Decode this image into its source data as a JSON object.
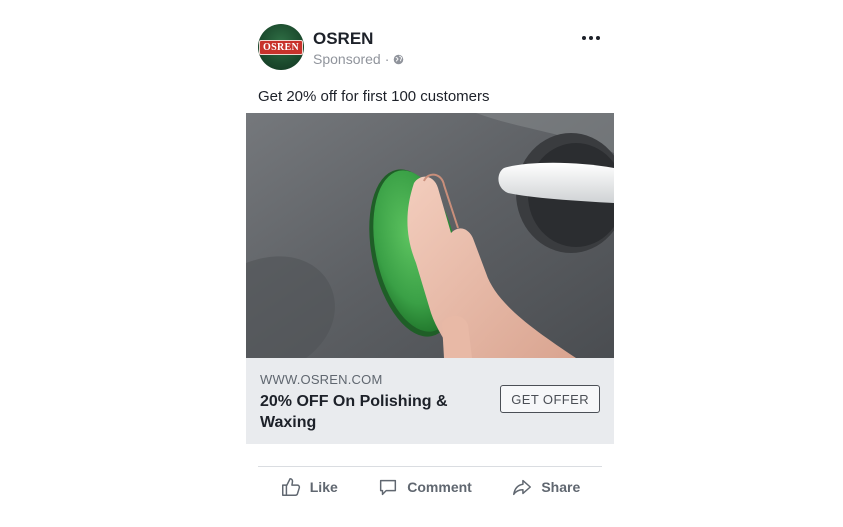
{
  "post": {
    "page_name": "OSREN",
    "avatar_text": "OSREN",
    "sponsored_label": "Sponsored",
    "separator": "·",
    "caption": "Get 20% off for first 100 customers",
    "image_icon": "car-polishing-photo"
  },
  "link": {
    "url": "WWW.OSREN.COM",
    "title": "20% OFF On Polishing & Waxing",
    "cta_label": "GET OFFER"
  },
  "actions": {
    "like_label": "Like",
    "comment_label": "Comment",
    "share_label": "Share"
  },
  "colors": {
    "text_primary": "#1d2129",
    "text_secondary": "#606770",
    "link_box_bg": "#e9ebee",
    "sponge_green": "#3aa046"
  }
}
